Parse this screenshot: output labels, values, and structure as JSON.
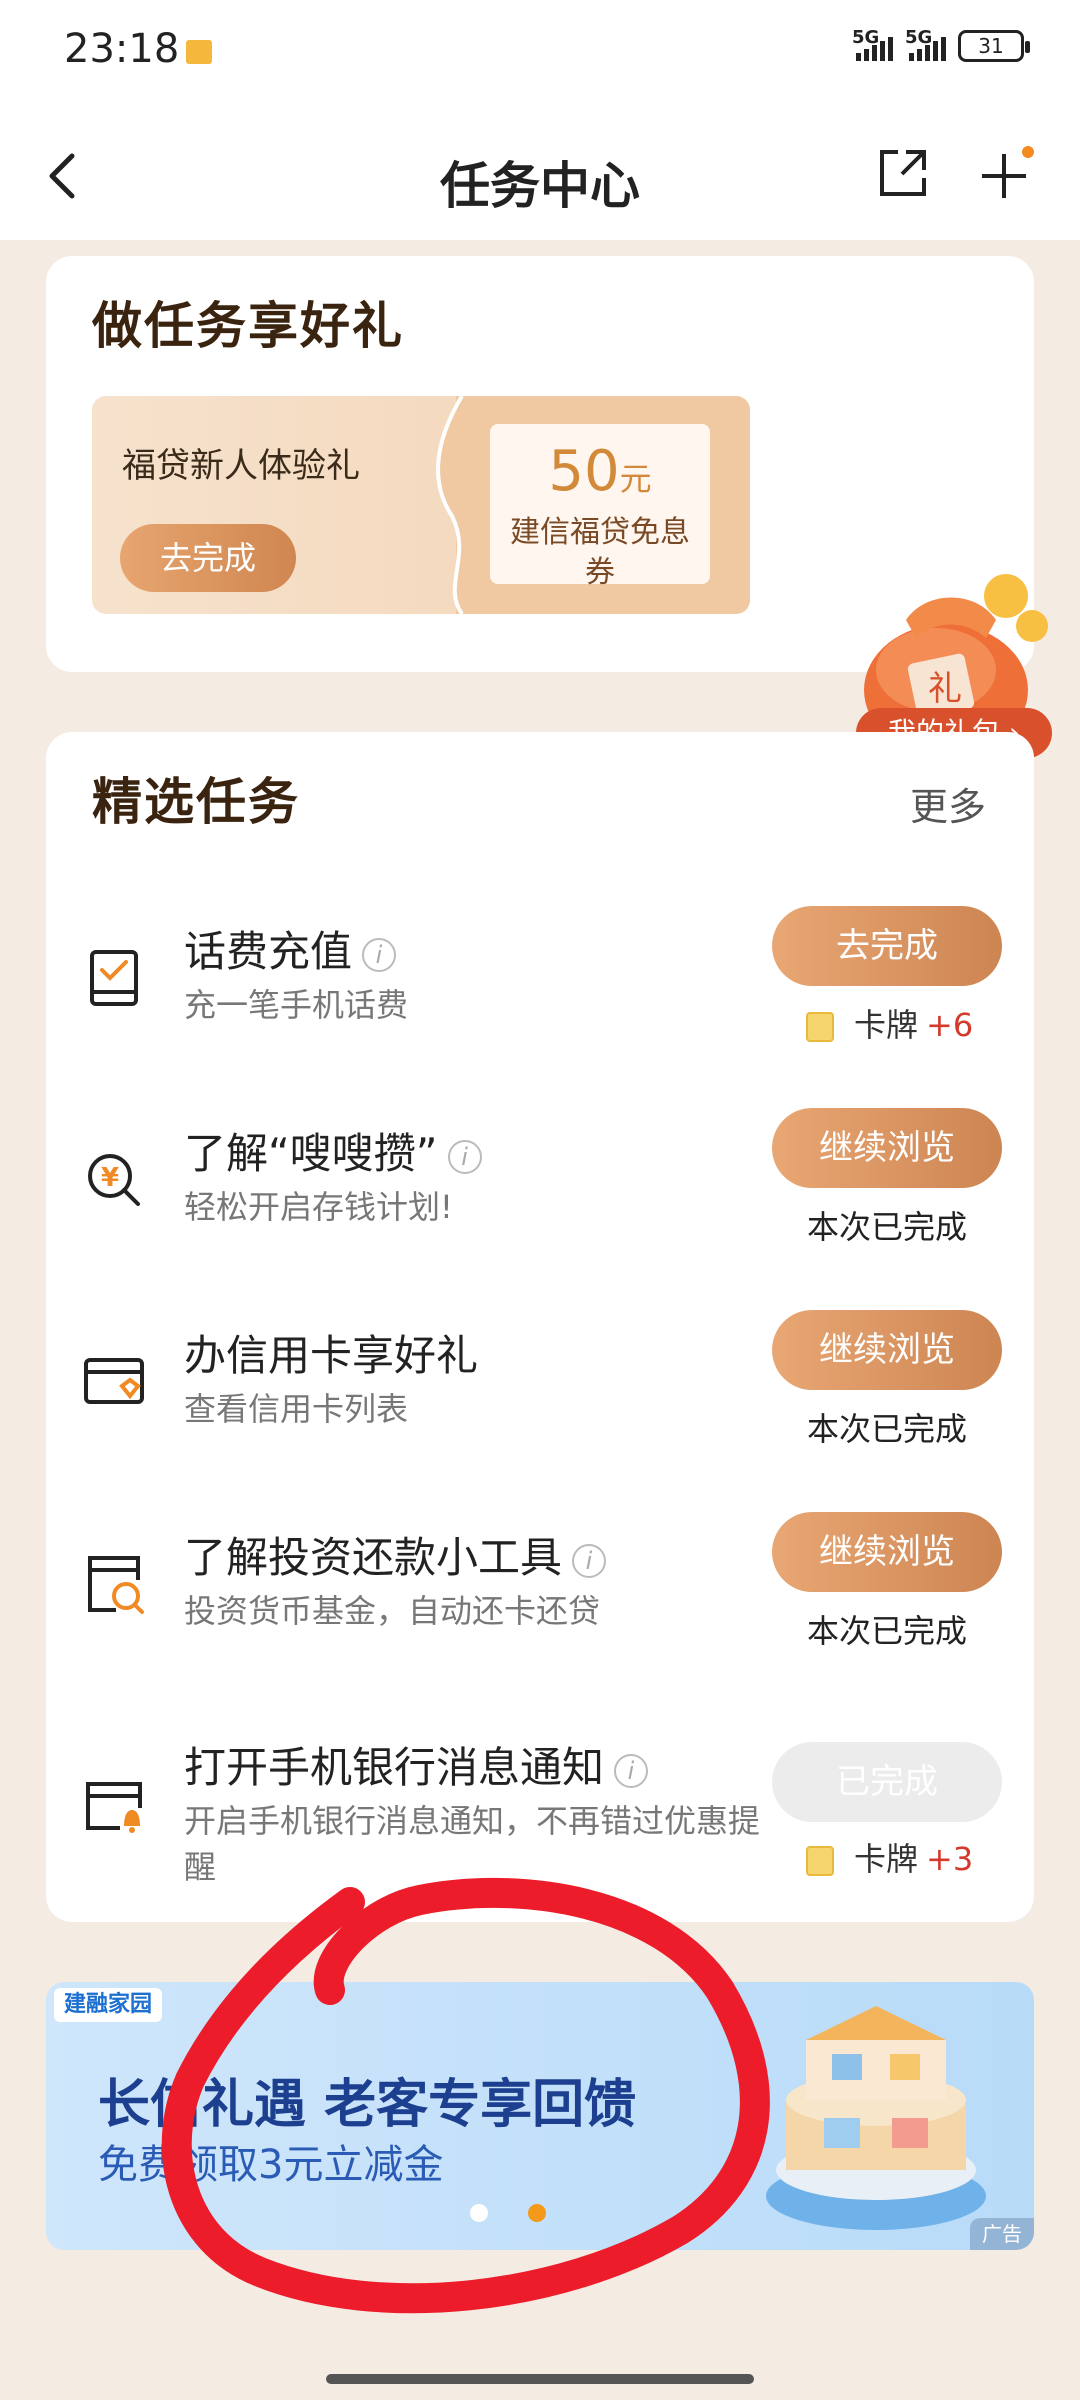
{
  "status_bar": {
    "time": "23:18",
    "signal1": "5G",
    "signal2": "5G",
    "battery": "31"
  },
  "nav": {
    "title": "任务中心"
  },
  "section1": {
    "title": "做任务享好礼",
    "gift": {
      "label": "福贷新人体验礼",
      "button": "去完成",
      "amount": "50",
      "unit": "元",
      "desc": "建信福贷免息券"
    }
  },
  "gift_bag": {
    "label": "我的礼包 ›",
    "bag_char": "礼"
  },
  "section2": {
    "title": "精选任务",
    "more": "更多",
    "tasks": [
      {
        "title": "话费充值",
        "subtitle": "充一笔手机话费",
        "button": "去完成",
        "reward_label": "卡牌",
        "reward_value": "+6"
      },
      {
        "title": "了解“嗖嗖攒”",
        "subtitle": "轻松开启存钱计划!",
        "button": "继续浏览",
        "status": "本次已完成"
      },
      {
        "title": "办信用卡享好礼",
        "subtitle": "查看信用卡列表",
        "button": "继续浏览",
        "status": "本次已完成"
      },
      {
        "title": "了解投资还款小工具",
        "subtitle": "投资货币基金，自动还卡还贷",
        "button": "继续浏览",
        "status": "本次已完成"
      },
      {
        "title": "打开手机银行消息通知",
        "subtitle": "开启手机银行消息通知，不再错过优惠提醒",
        "button": "已完成",
        "reward_label": "卡牌",
        "reward_value": "+3"
      }
    ]
  },
  "banner": {
    "logo": "建融家园",
    "title": "长信礼遇 老客专享回馈",
    "subtitle": "免费领取3元立减金",
    "ad_label": "广告"
  },
  "colors": {
    "accent_orange": "#d08650",
    "page_bg": "#f4ebe3",
    "reward_red": "#d43a2c",
    "scribble_red": "#ec1c2a"
  }
}
